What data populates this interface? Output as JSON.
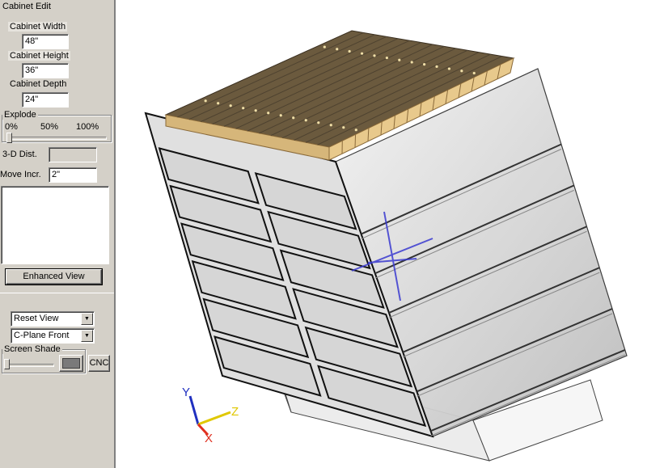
{
  "panel": {
    "title": "Cabinet Edit",
    "width_label": "Cabinet Width",
    "width_value": "48\"",
    "height_label": "Cabinet Height",
    "height_value": "36\"",
    "depth_label": "Cabinet Depth",
    "depth_value": "24\"",
    "explode": {
      "title": "Explode",
      "tick_0": "0%",
      "tick_50": "50%",
      "tick_100": "100%",
      "level": 0
    },
    "dist_label": "3-D Dist.",
    "dist_value": "",
    "move_label": "Move Incr.",
    "move_value": "2\"",
    "enhanced_view_label": "Enhanced View",
    "view_select": "Reset View",
    "cplane_select": "C-Plane Front",
    "shade": {
      "title": "Screen Shade",
      "level": 0,
      "swatch_color": "#7a7a7a"
    },
    "cnc_label": "CNC"
  },
  "viewport": {
    "axis_x": "X",
    "axis_y": "Y",
    "axis_z": "Z",
    "colors": {
      "axis_x": "#e03020",
      "axis_y": "#2030c0",
      "axis_z": "#e0c800",
      "top_wood": "#6b5a3e",
      "top_edge": "#e8c98c",
      "frame": "#202020",
      "glass": "#d8d8d8",
      "cursor": "#3a3ad0"
    }
  }
}
